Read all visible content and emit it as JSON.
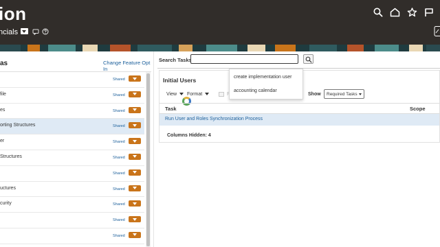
{
  "header": {
    "brand": "ion",
    "app_name": "ncials",
    "icons": [
      "search-icon",
      "home-icon",
      "favorites-star-icon",
      "flag-icon",
      "chat-icon",
      "help-icon",
      "edit-icon"
    ]
  },
  "left_panel": {
    "title": "as",
    "change_feature_link": "Change Feature Opt In",
    "rows": [
      {
        "label": "",
        "shared": "Shared"
      },
      {
        "label": "file",
        "shared": "Shared"
      },
      {
        "label": "es",
        "shared": "Shared"
      },
      {
        "label": "orting Structures",
        "shared": "Shared",
        "selected": true
      },
      {
        "label": "er",
        "shared": "Shared"
      },
      {
        "label": "Structures",
        "shared": "Shared"
      },
      {
        "label": "",
        "shared": "Shared"
      },
      {
        "label": "uctures",
        "shared": "Shared"
      },
      {
        "label": "curity",
        "shared": "Shared"
      },
      {
        "label": "",
        "shared": "Shared"
      },
      {
        "label": "",
        "shared": "Shared"
      }
    ]
  },
  "search": {
    "label": "Search Tasks",
    "value": "",
    "suggestions": [
      "create implementation user",
      "accounting calendar"
    ]
  },
  "table_card": {
    "title": "Initial Users",
    "view_label": "View",
    "format_label": "Format",
    "freeze_label": "F",
    "show_label": "Show",
    "show_value": "Required Tasks",
    "columns": {
      "task": "Task",
      "scope": "Scope"
    },
    "rows": [
      {
        "task": "Run User and Roles Synchronization Process"
      }
    ],
    "columns_hidden": "Columns Hidden: 4"
  },
  "colors": {
    "header_bg": "#312d2a",
    "accent_orange": "#c9741a",
    "link_blue": "#1a5e9a",
    "selected_row": "#dfeaf5"
  }
}
